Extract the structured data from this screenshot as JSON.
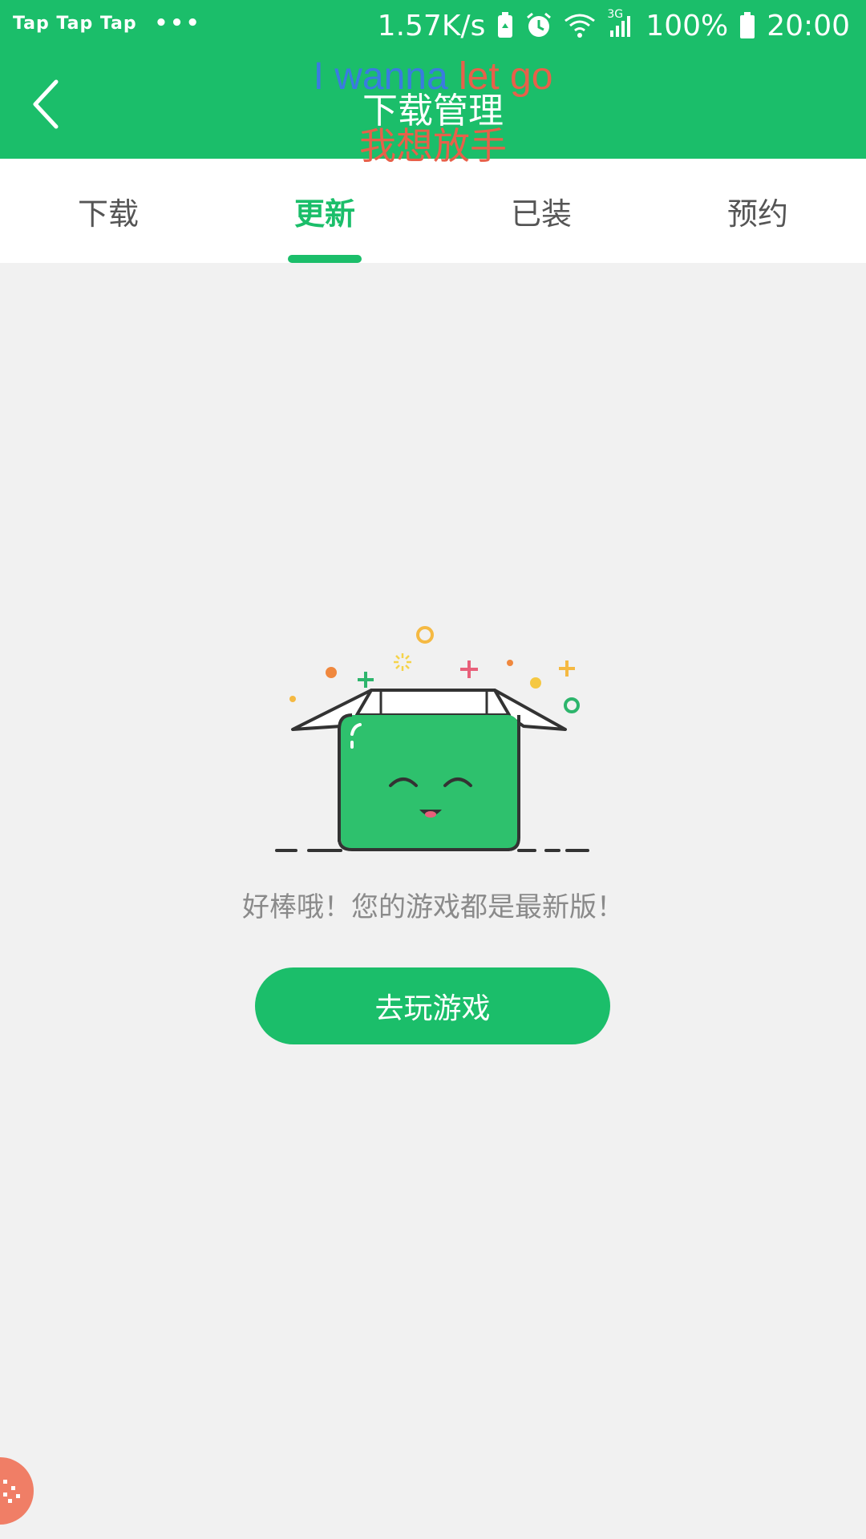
{
  "status_bar": {
    "app_labels": "Tap Tap Tap",
    "more_dots": "•••",
    "net_speed": "1.57K/s",
    "network_type": "3G",
    "battery_percent": "100%",
    "time": "20:00"
  },
  "header": {
    "title": "下载管理",
    "lyric_en_part1": "I wanna ",
    "lyric_en_part2": "let go",
    "lyric_zh": "我想放手"
  },
  "tabs": [
    {
      "label": "下载",
      "active": false
    },
    {
      "label": "更新",
      "active": true
    },
    {
      "label": "已装",
      "active": false
    },
    {
      "label": "预约",
      "active": false
    }
  ],
  "empty_state": {
    "illustration": "happy-open-box",
    "message": "好棒哦！您的游戏都是最新版！",
    "button_label": "去玩游戏"
  },
  "colors": {
    "brand_green": "#1bbe6a",
    "background": "#f1f1f1",
    "float_button": "#f07e66"
  }
}
